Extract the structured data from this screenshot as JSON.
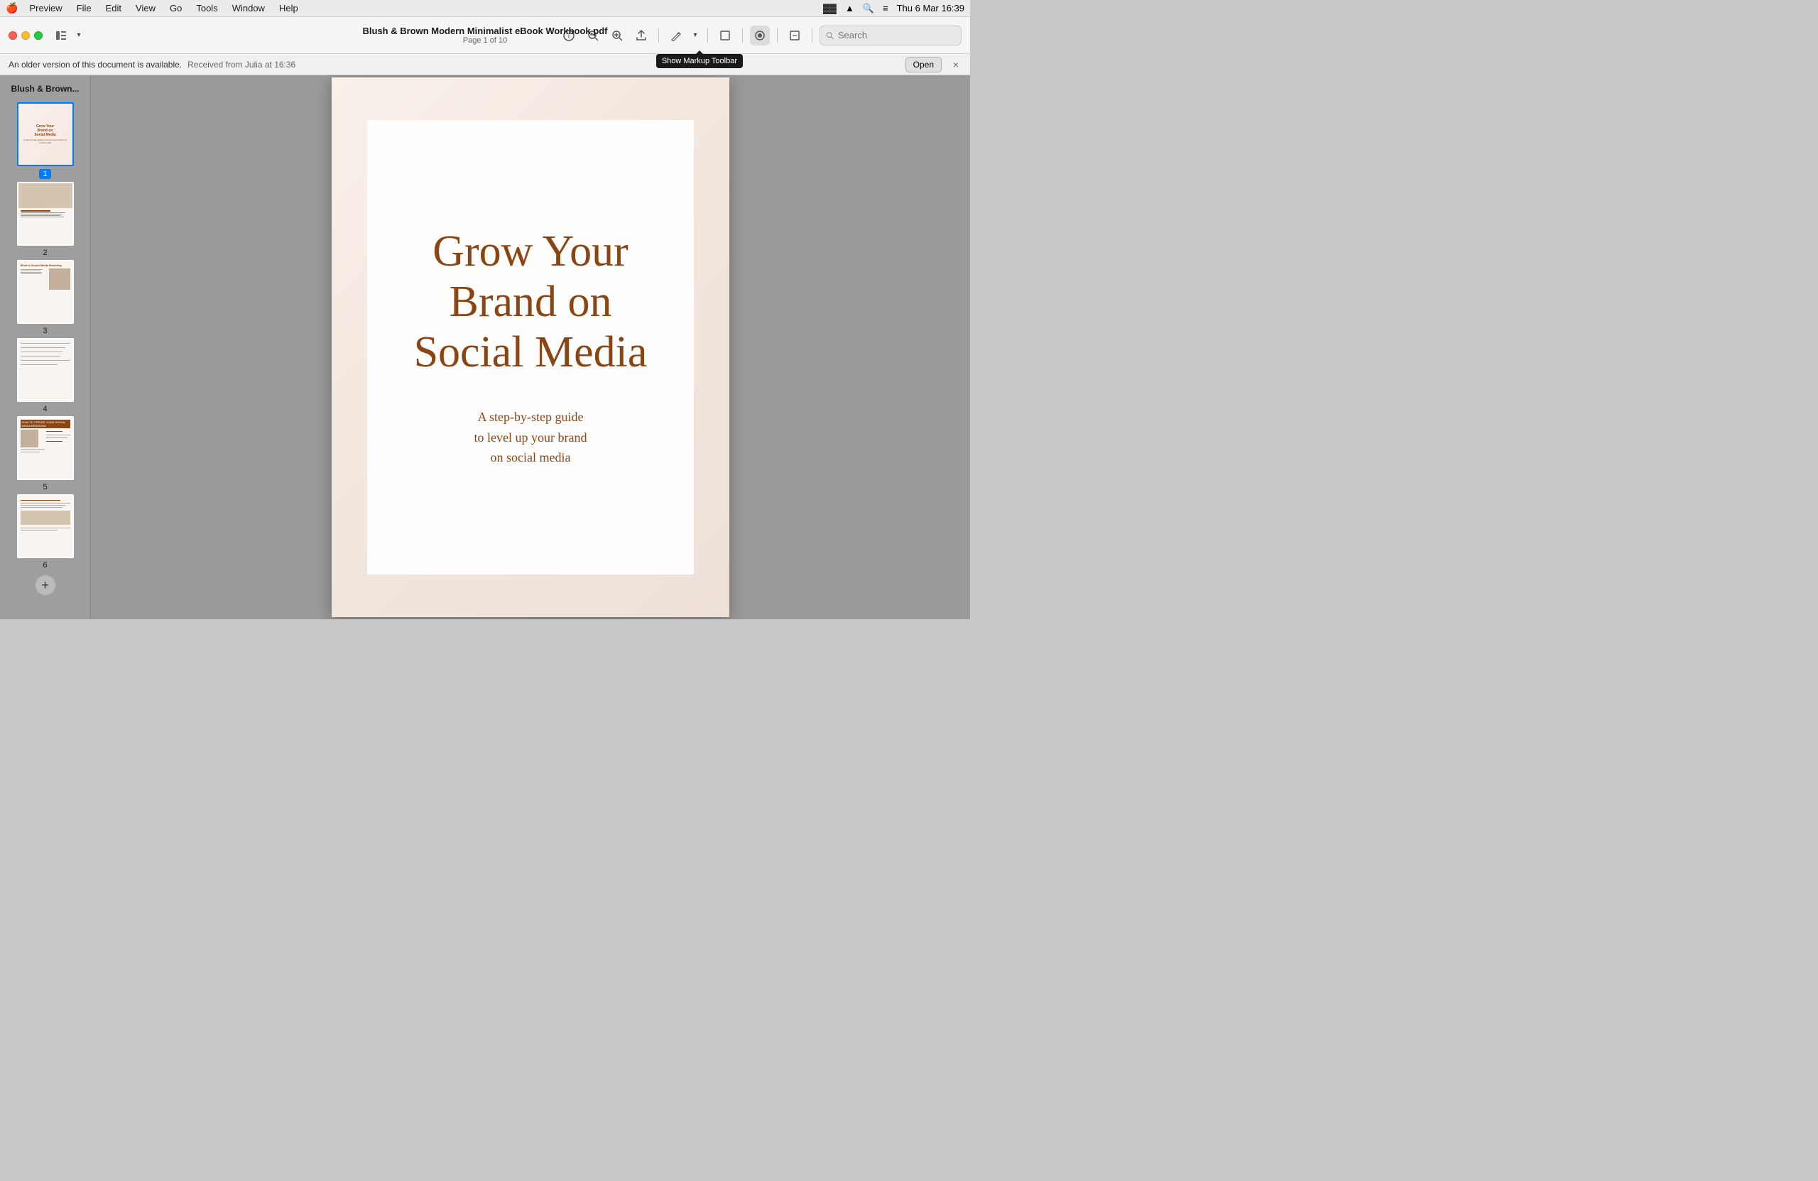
{
  "app": {
    "name": "Preview",
    "menu_items": [
      "🍎",
      "Preview",
      "File",
      "Edit",
      "View",
      "Go",
      "Tools",
      "Window",
      "Help"
    ]
  },
  "system_bar": {
    "left_icons": [
      "screen_icon",
      "play_icon",
      "A_icon",
      "battery_icon",
      "wifi_icon"
    ],
    "time": "Thu 6 Mar  16:39",
    "right_icons": [
      "search_icon",
      "control_center_icon"
    ]
  },
  "toolbar": {
    "doc_name": "Blush & Brown Modern Minimalist eBook Workbook.pdf",
    "doc_page": "Page 1 of 10",
    "search_placeholder": "Search",
    "buttons": {
      "sidebar_toggle": "☰",
      "info": "ⓘ",
      "zoom_out": "−",
      "zoom_in": "+",
      "share": "↑",
      "markup": "✏",
      "markup_dropdown": "▾",
      "resize": "⤢",
      "highlight": "◉",
      "edit": "☐"
    }
  },
  "notification": {
    "message": "An older version of this document is available.",
    "detail": "Received from Julia at 16:36",
    "open_label": "Open",
    "close_label": "×"
  },
  "markup_tooltip": {
    "text": "Show Markup Toolbar"
  },
  "sidebar": {
    "header": "Blush & Brown...",
    "pages": [
      {
        "num": "1",
        "label": "Grow Your Brand on Social Media",
        "active": true
      },
      {
        "num": "2",
        "label": "Hello and Welcome!",
        "active": false
      },
      {
        "num": "3",
        "label": "What is Social Media Branding",
        "active": false
      },
      {
        "num": "4",
        "label": "",
        "active": false
      },
      {
        "num": "5",
        "label": "How to Create Your Social Media Branding",
        "active": false
      },
      {
        "num": "6",
        "label": "",
        "active": false
      }
    ],
    "add_page": "+"
  },
  "pdf_page": {
    "main_title": "Grow Your Brand on Social Media",
    "subtitle_line1": "A step-by-step guide",
    "subtitle_line2": "to level up your brand",
    "subtitle_line3": "on social media"
  },
  "colors": {
    "brown": "#8b4513",
    "blush": "#f9f0ea",
    "toolbar_bg": "#f5f5f5",
    "sidebar_bg": "#9e9e9e",
    "content_bg": "#9a9a9a"
  }
}
